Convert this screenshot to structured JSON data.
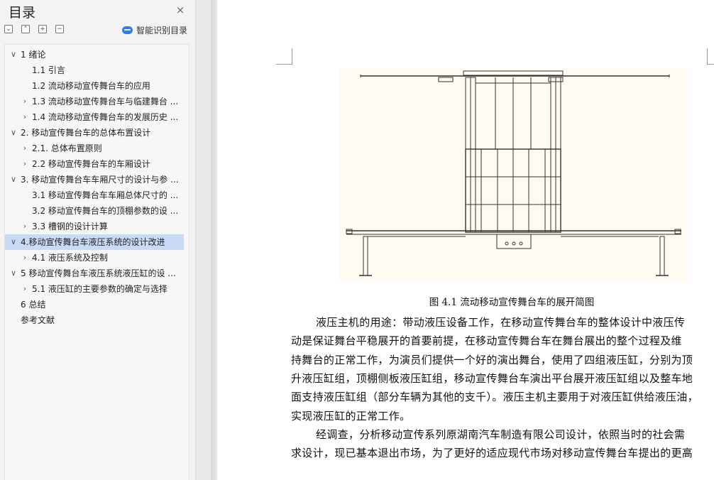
{
  "sidebar": {
    "title": "目录",
    "close_icon": "×",
    "toolbar": [
      {
        "name": "expand-all-button",
        "glyph": "⌄"
      },
      {
        "name": "collapse-all-button",
        "glyph": "⌃"
      },
      {
        "name": "add-heading-button",
        "glyph": "+"
      },
      {
        "name": "remove-heading-button",
        "glyph": "−"
      }
    ],
    "smart_toc_label": "智能识别目录",
    "items": [
      {
        "label": "1  绪论",
        "level": 0,
        "chevron": "expanded"
      },
      {
        "label": "1.1  引言",
        "level": 1,
        "chevron": "none"
      },
      {
        "label": "1.2  流动移动宣传舞台车的应用",
        "level": 1,
        "chevron": "none"
      },
      {
        "label": "1.3  流动移动宣传舞台车与临建舞台 ...",
        "level": 1,
        "chevron": "collapsed"
      },
      {
        "label": "1.4  流动移动宣传舞台车的发展历史 ...",
        "level": 1,
        "chevron": "collapsed"
      },
      {
        "label": "2.  移动宣传舞台车的总体布置设计",
        "level": 0,
        "chevron": "expanded"
      },
      {
        "label": "2.1.  总体布置原则",
        "level": 1,
        "chevron": "collapsed"
      },
      {
        "label": "2.2  移动宣传舞台车的车厢设计",
        "level": 1,
        "chevron": "collapsed"
      },
      {
        "label": "3.  移动宣传舞台车车厢尺寸的设计与参 ...",
        "level": 0,
        "chevron": "expanded"
      },
      {
        "label": "3.1  移动宣传舞台车车厢总体尺寸的 ...",
        "level": 1,
        "chevron": "none"
      },
      {
        "label": "3.2  移动宣传舞台车的顶棚参数的设 ...",
        "level": 1,
        "chevron": "none"
      },
      {
        "label": "3.3  槽钢的设计计算",
        "level": 1,
        "chevron": "collapsed"
      },
      {
        "label": "4.移动宣传舞台车液压系统的设计改进",
        "level": 0,
        "chevron": "expanded",
        "selected": true
      },
      {
        "label": "4.1  液压系统及控制",
        "level": 1,
        "chevron": "collapsed"
      },
      {
        "label": "5  移动宣传舞台车液压系统液压缸的设 ...",
        "level": 0,
        "chevron": "expanded"
      },
      {
        "label": "5.1  液压缸的主要参数的确定与选择",
        "level": 1,
        "chevron": "collapsed"
      },
      {
        "label": "6 总结",
        "level": 0,
        "chevron": "none"
      },
      {
        "label": "参考文献",
        "level": 0,
        "chevron": "none"
      }
    ]
  },
  "document": {
    "figure_caption": "图 4.1  流动移动宣传舞台车的展开简图",
    "paragraph_lines": [
      "液压主机的用途：带动液压设备工作，在移动宣传舞台车的整体设计中液压传",
      "动是保证舞台平稳展开的首要前提，在移动宣传舞台车在舞台展出的整个过程及维",
      "持舞台的正常工作，为演员们提供一个好的演出舞台，使用了四组液压缸，分别为顶",
      "升液压缸组，顶棚侧板液压缸组，移动宣传舞台车演出平台展开液压缸组以及整车地",
      "面支持液压缸组（部分车辆为其他的支千）。液压主机主要用于对液压缸供给液压油，",
      "实现液压缸的正常工作。",
      "经调查，分析移动宣传系列原湖南汽车制造有限公司设计，依照当时的社会需",
      "求设计，现已基本退出市场，为了更好的适应现代市场对移动宣传舞台车提出的更高"
    ]
  }
}
